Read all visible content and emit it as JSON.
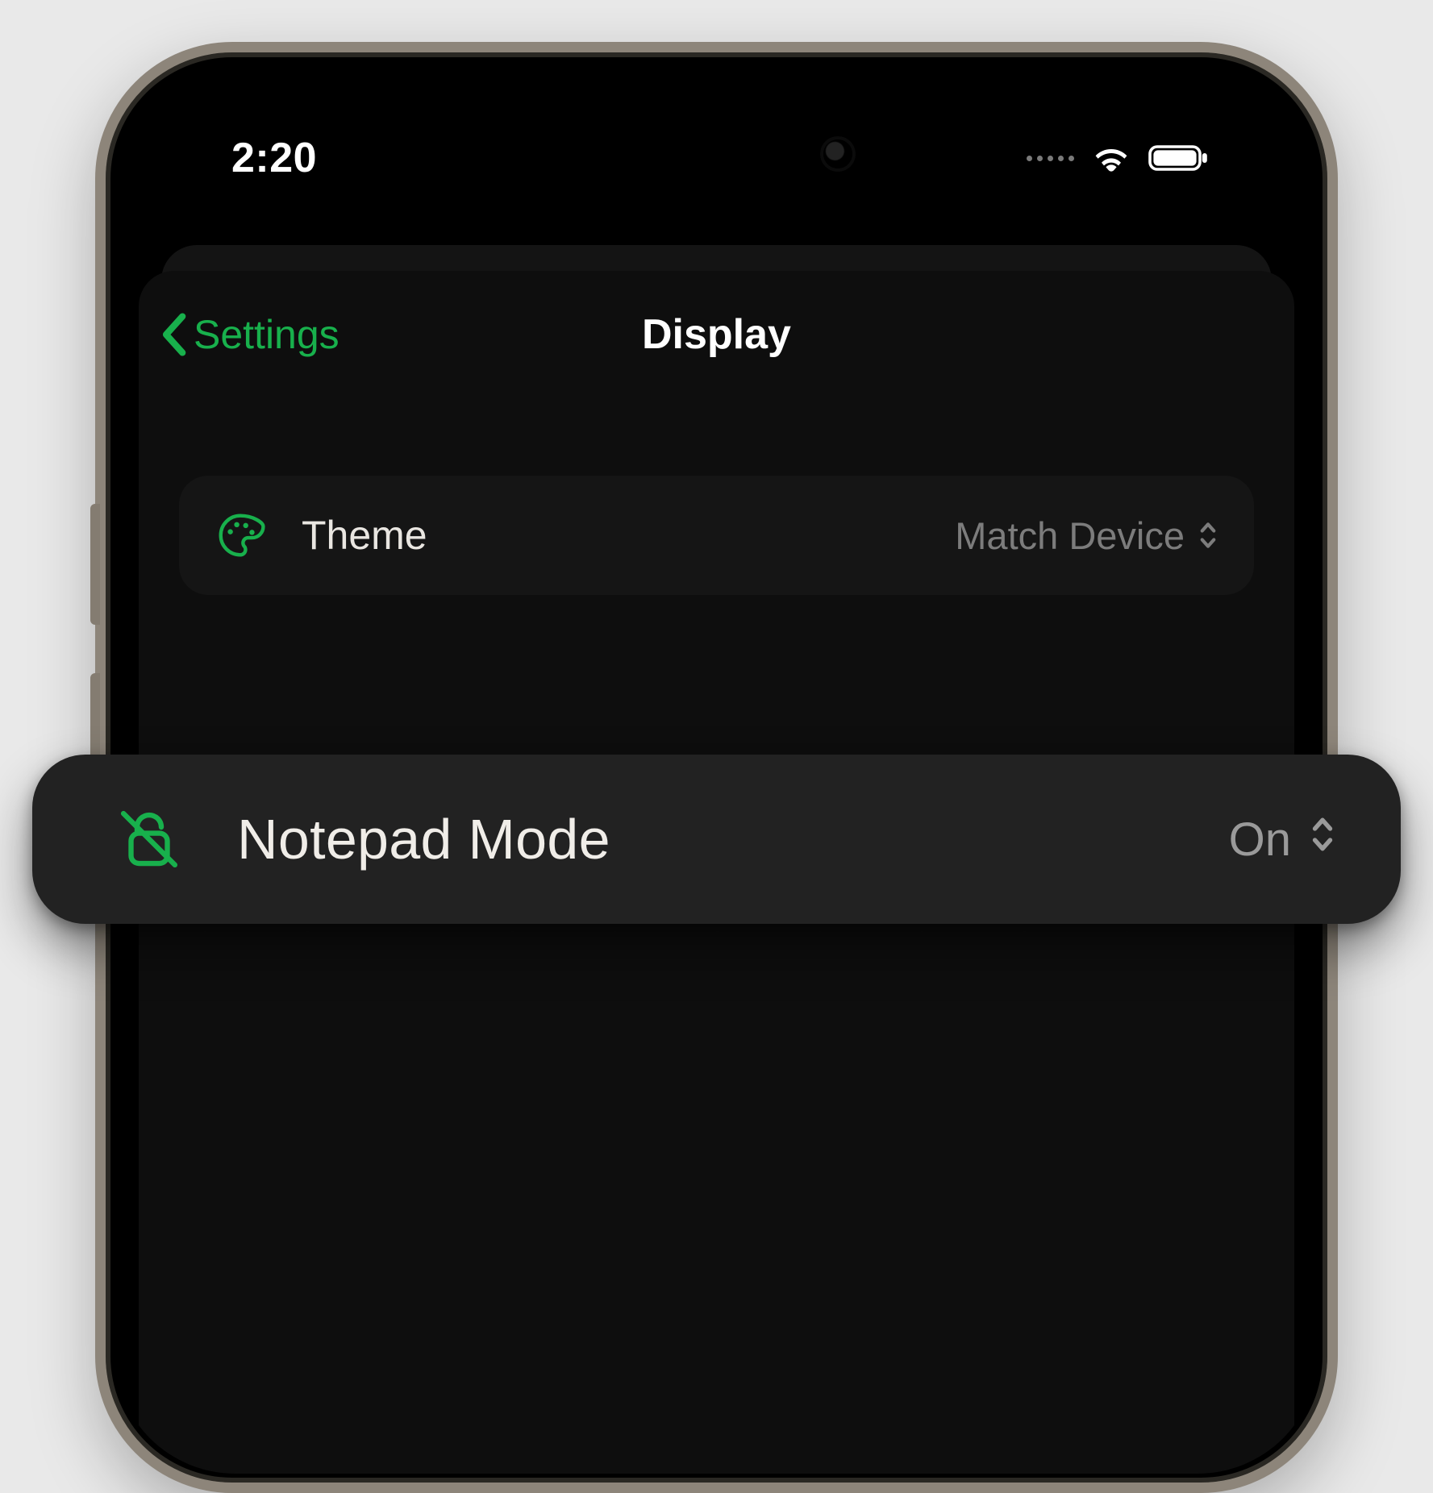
{
  "statusbar": {
    "time": "2:20"
  },
  "nav": {
    "back_label": "Settings",
    "title": "Display"
  },
  "rows": {
    "theme": {
      "label": "Theme",
      "value": "Match Device"
    }
  },
  "pill": {
    "label": "Notepad Mode",
    "value": "On"
  },
  "colors": {
    "accent": "#18b04c"
  }
}
